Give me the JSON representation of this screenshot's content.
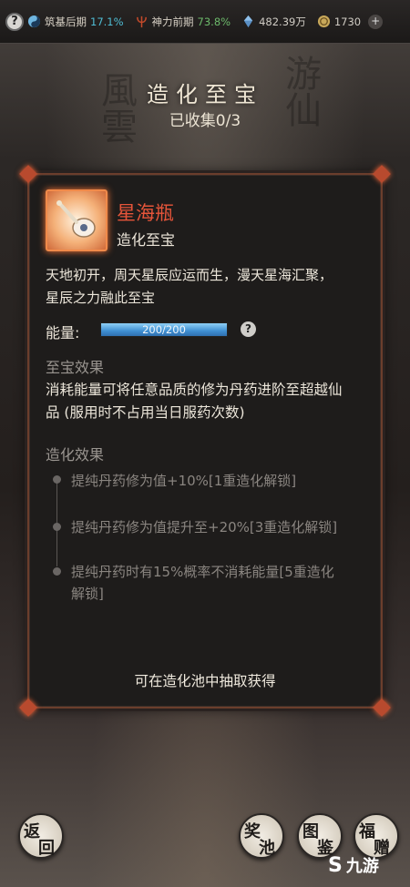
{
  "topbar": {
    "stage_label": "筑基后期",
    "stage_pct": "17.1%",
    "power_label": "神力前期",
    "power_pct": "73.8%",
    "gems": "482.39万",
    "coins": "1730",
    "plus": "+",
    "help": "?"
  },
  "header": {
    "title": "造化至宝",
    "subtitle": "已收集0/3"
  },
  "item": {
    "name": "星海瓶",
    "type": "造化至宝",
    "description_line1": "天地初开，周天星辰应运而生，漫天星海汇聚，",
    "description_line2": "星辰之力融此至宝",
    "energy_label": "能量:",
    "energy_value": 200,
    "energy_max": 200,
    "energy_text": "200/200",
    "energy_fill_fraction": 1.0,
    "energy_help": "?"
  },
  "treasure_effect": {
    "title": "至宝效果",
    "line1": "消耗能量可将任意品质的修为丹药进阶至超越仙",
    "line2": "品 (服用时不占用当日服药次数)"
  },
  "craft_effect": {
    "title": "造化效果",
    "items": [
      {
        "line1": "提纯丹药修为值+10%[1重造化解锁]",
        "line2": ""
      },
      {
        "line1": "提纯丹药修为值提升至+20%[3重造化解锁]",
        "line2": ""
      },
      {
        "line1": "提纯丹药时有15%概率不消耗能量[5重造化",
        "line2": "解锁]"
      }
    ]
  },
  "source_text": "可在造化池中抽取获得",
  "bottom": {
    "back": [
      "返",
      "回"
    ],
    "pool": [
      "奖",
      "池"
    ],
    "atlas": [
      "图",
      "鉴"
    ],
    "gift": [
      "福",
      "赠"
    ]
  },
  "watermark": {
    "mark": "S",
    "text": "九游"
  },
  "colors": {
    "accent_red": "#e6553a",
    "energy_blue": "#3f8fd2",
    "pct_cyan": "#4fbdd4",
    "pct_green": "#6cb86a"
  }
}
